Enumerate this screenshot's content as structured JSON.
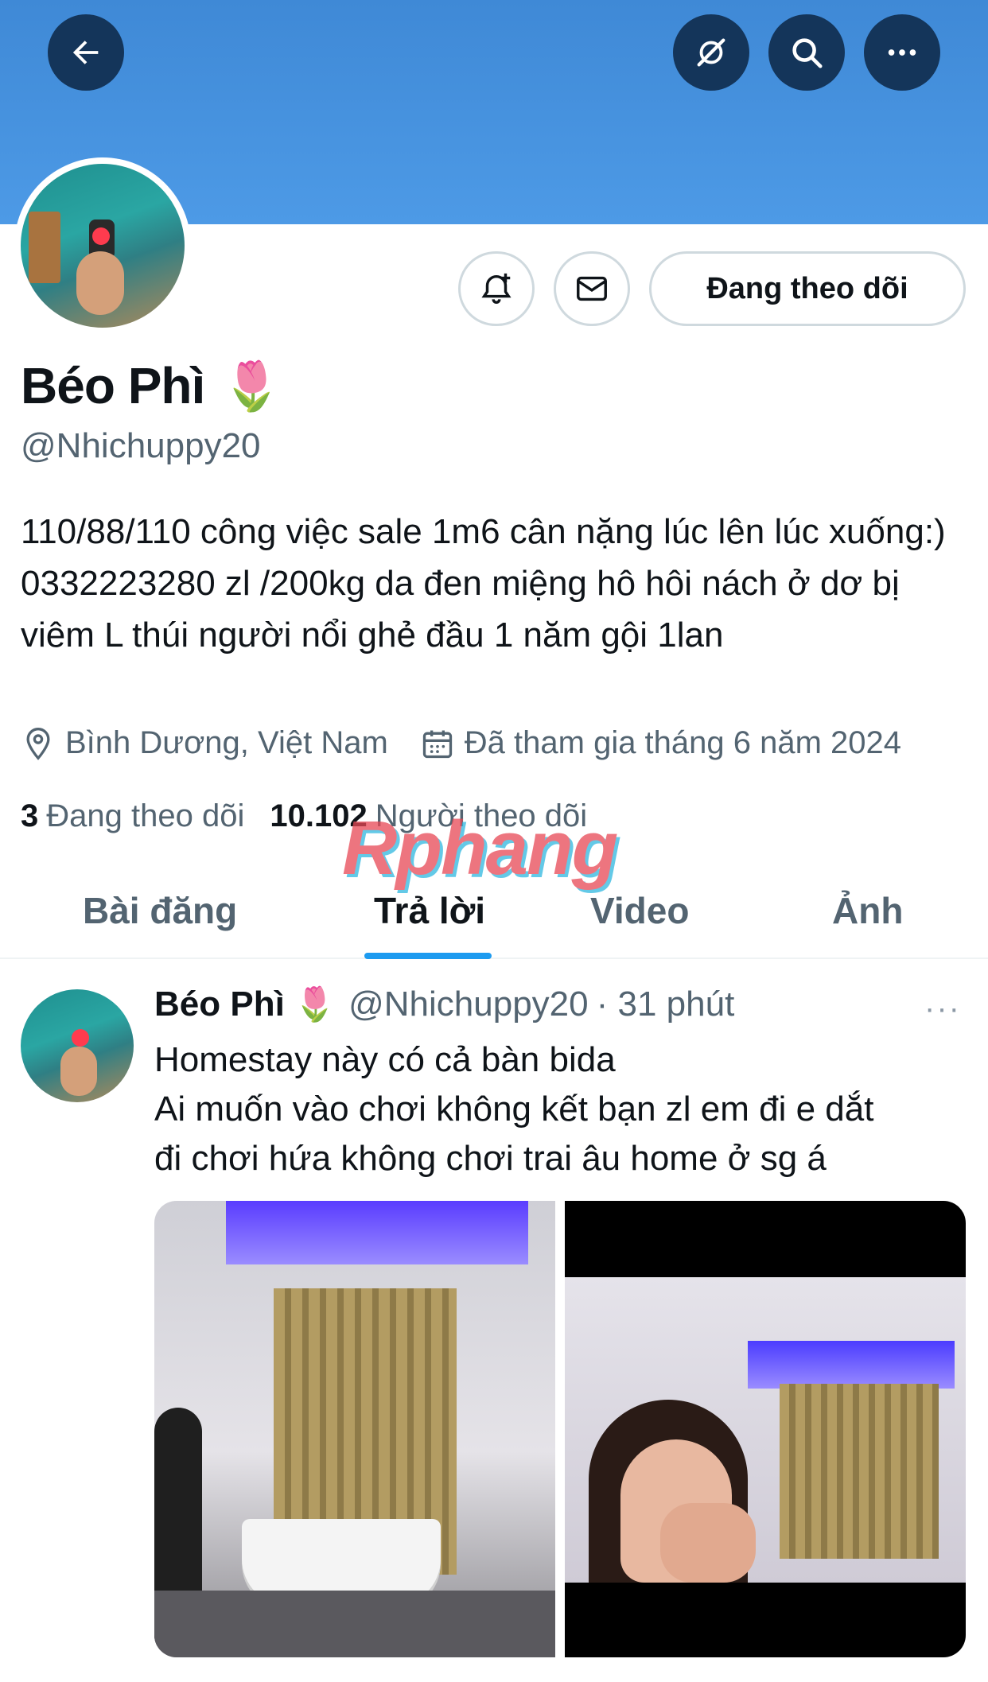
{
  "colors": {
    "banner": "#4d9ae6",
    "nav_button_bg": "#14355a",
    "accent": "#1d9bf0",
    "text_primary": "#0f1419",
    "text_secondary": "#536471"
  },
  "top_bar": {
    "icons": [
      "back-arrow-icon",
      "grok-icon",
      "search-icon",
      "more-icon"
    ]
  },
  "profile": {
    "actions": {
      "notify_icon": "bell-plus-icon",
      "message_icon": "mail-icon",
      "follow_label": "Đang theo dõi"
    },
    "name": "Béo Phì",
    "name_emoji": "🌷",
    "handle": "@Nhichuppy20",
    "bio": "110/88/110 công việc sale 1m6 cân nặng lúc lên lúc xuống:) 0332223280 zl /200kg da đen miệng hô hôi nách ở dơ bị viêm L thúi người nổi ghẻ đầu 1 năm gội 1lan",
    "location": "Bình Dương, Việt Nam",
    "joined": "Đã tham gia tháng 6 năm 2024",
    "following_count": "3",
    "following_label": "Đang theo dõi",
    "followers_count": "10.102",
    "followers_label": "Người theo dõi"
  },
  "watermark": "Rphang",
  "tabs": [
    {
      "label": "Bài đăng",
      "active": false
    },
    {
      "label": "Trả lời",
      "active": true
    },
    {
      "label": "Video",
      "active": false
    },
    {
      "label": "Ảnh",
      "active": false
    }
  ],
  "post": {
    "author": "Béo Phì",
    "author_emoji": "🌷",
    "handle": "@Nhichuppy20",
    "time": "· 31 phút",
    "more": "···",
    "text_lines": [
      "Homestay này có cả bàn bida",
      "Ai muốn vào chơi không kết bạn zl em đi e dắt",
      "đi chơi hứa không chơi trai âu home ở sg á"
    ]
  }
}
